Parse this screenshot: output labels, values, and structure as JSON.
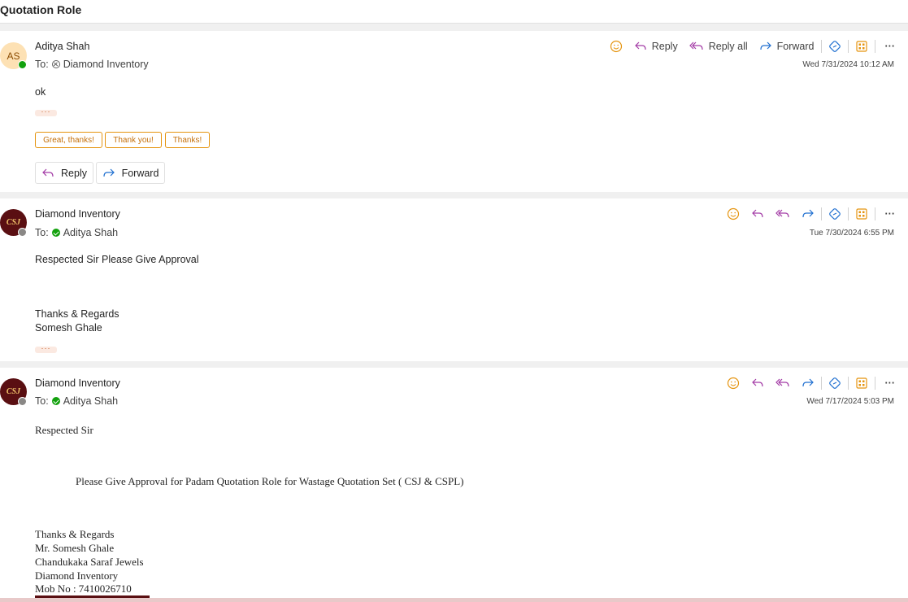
{
  "header": {
    "title": "Quotation Role"
  },
  "toolbar_labels": {
    "reply": "Reply",
    "reply_all": "Reply all",
    "forward": "Forward",
    "more": "···"
  },
  "messages": [
    {
      "sender": "Aditya Shah",
      "avatar_initials": "AS",
      "to_label": "To:",
      "recipient": "Diamond Inventory",
      "date": "Wed 7/31/2024 10:12 AM",
      "body": "ok",
      "quoted_indicator": "···",
      "suggested_replies": [
        "Great, thanks!",
        "Thank you!",
        "Thanks!"
      ],
      "actions": {
        "reply": "Reply",
        "forward": "Forward"
      }
    },
    {
      "sender": "Diamond Inventory",
      "avatar_text": "CSJ",
      "to_label": "To:",
      "recipient": "Aditya Shah",
      "date": "Tue 7/30/2024 6:55 PM",
      "body_line1": "Respected Sir Please Give Approval",
      "signoff1": "Thanks & Regards",
      "signoff2": "Somesh Ghale",
      "quoted_indicator": "···"
    },
    {
      "sender": "Diamond Inventory",
      "avatar_text": "CSJ",
      "to_label": "To:",
      "recipient": "Aditya Shah",
      "date": "Wed 7/17/2024 5:03 PM",
      "greeting": "Respected Sir",
      "body_line": "Please Give Approval for Padam Quotation Role for Wastage Quotation Set ( CSJ & CSPL)",
      "sig": [
        "Thanks & Regards",
        "Mr. Somesh Ghale",
        "Chandukaka Saraf Jewels",
        "Diamond Inventory",
        "Mob No : 7410026710"
      ]
    }
  ],
  "colors": {
    "accent_orange": "#e5940f",
    "reply_purple": "#a33ca6",
    "forward_blue": "#1f6fd0",
    "brand_maroon": "#5a0f12",
    "presence_green": "#13a10e"
  }
}
